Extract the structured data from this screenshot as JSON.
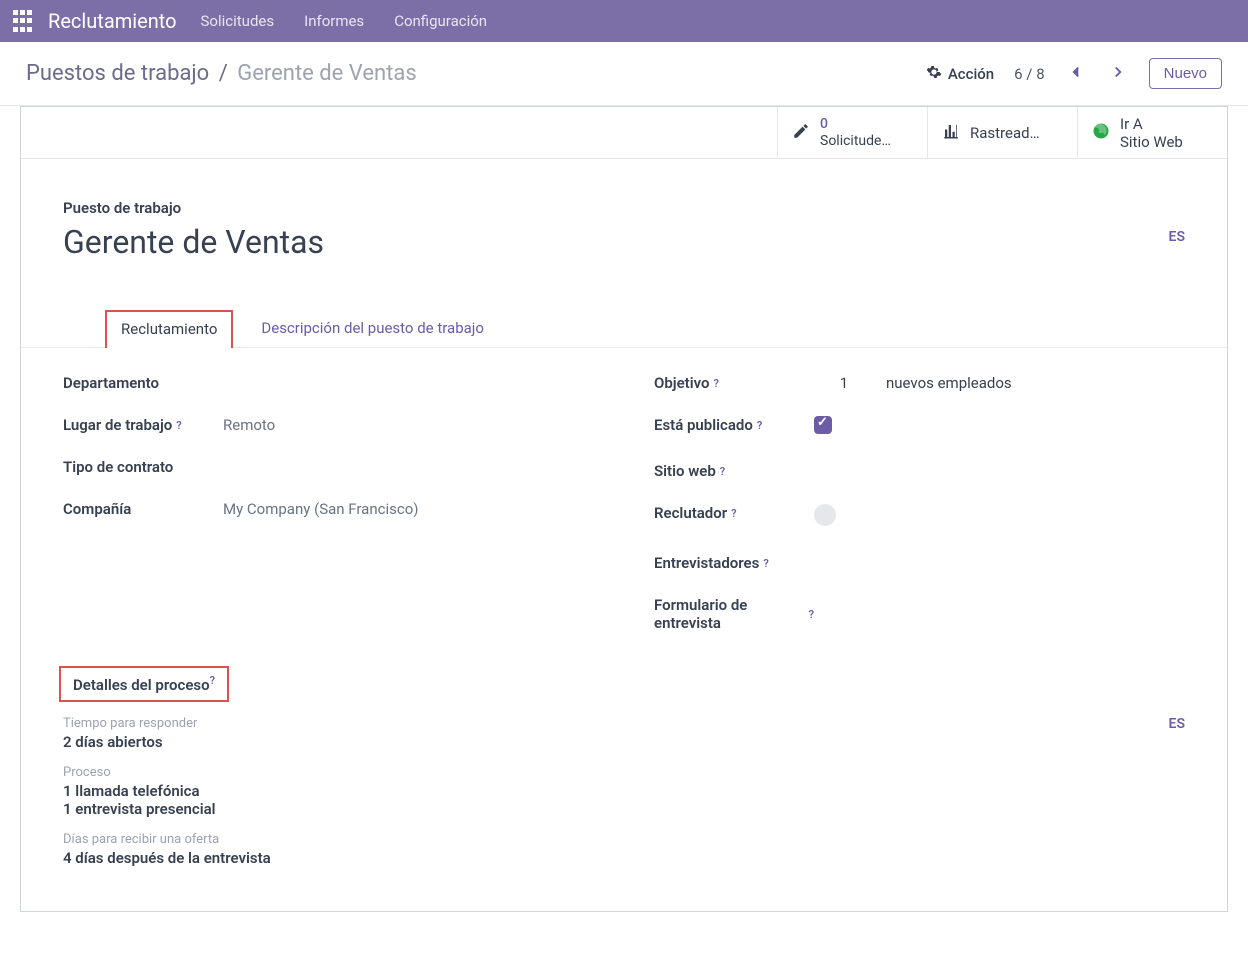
{
  "nav": {
    "brand": "Reclutamiento",
    "items": [
      "Solicitudes",
      "Informes",
      "Configuración"
    ]
  },
  "breadcrumb": {
    "parent": "Puestos de trabajo",
    "current": "Gerente de Ventas"
  },
  "actions": {
    "action_label": "Acción",
    "pager": "6 / 8",
    "new_label": "Nuevo"
  },
  "stats": {
    "applications": {
      "count": "0",
      "label": "Solicitude…"
    },
    "trackers": {
      "label": "Rastread…"
    },
    "website": {
      "line1": "Ir A",
      "line2": "Sitio Web"
    }
  },
  "form": {
    "job_label": "Puesto de trabajo",
    "job_title": "Gerente de Ventas",
    "lang": "ES",
    "tabs": {
      "recruitment": "Reclutamiento",
      "description": "Descripción del puesto de trabajo"
    },
    "fields": {
      "department_label": "Departamento",
      "workplace_label": "Lugar de trabajo",
      "workplace_value": "Remoto",
      "contract_label": "Tipo de contrato",
      "company_label": "Compañía",
      "company_value": "My Company (San Francisco)",
      "target_label": "Objetivo",
      "target_value": "1",
      "target_suffix": "nuevos empleados",
      "published_label": "Está publicado",
      "website_label": "Sitio web",
      "recruiter_label": "Reclutador",
      "interviewers_label": "Entrevistadores",
      "interview_form_label": "Formulario de entrevista"
    },
    "process": {
      "header": "Detalles del proceso",
      "respond_label": "Tiempo para responder",
      "respond_value": "2 días abiertos",
      "process_label": "Proceso",
      "process_line1": "1 llamada telefónica",
      "process_line2": "1 entrevista presencial",
      "offer_label": "Días para recibir una oferta",
      "offer_value": "4 días después de la entrevista",
      "lang": "ES"
    }
  }
}
